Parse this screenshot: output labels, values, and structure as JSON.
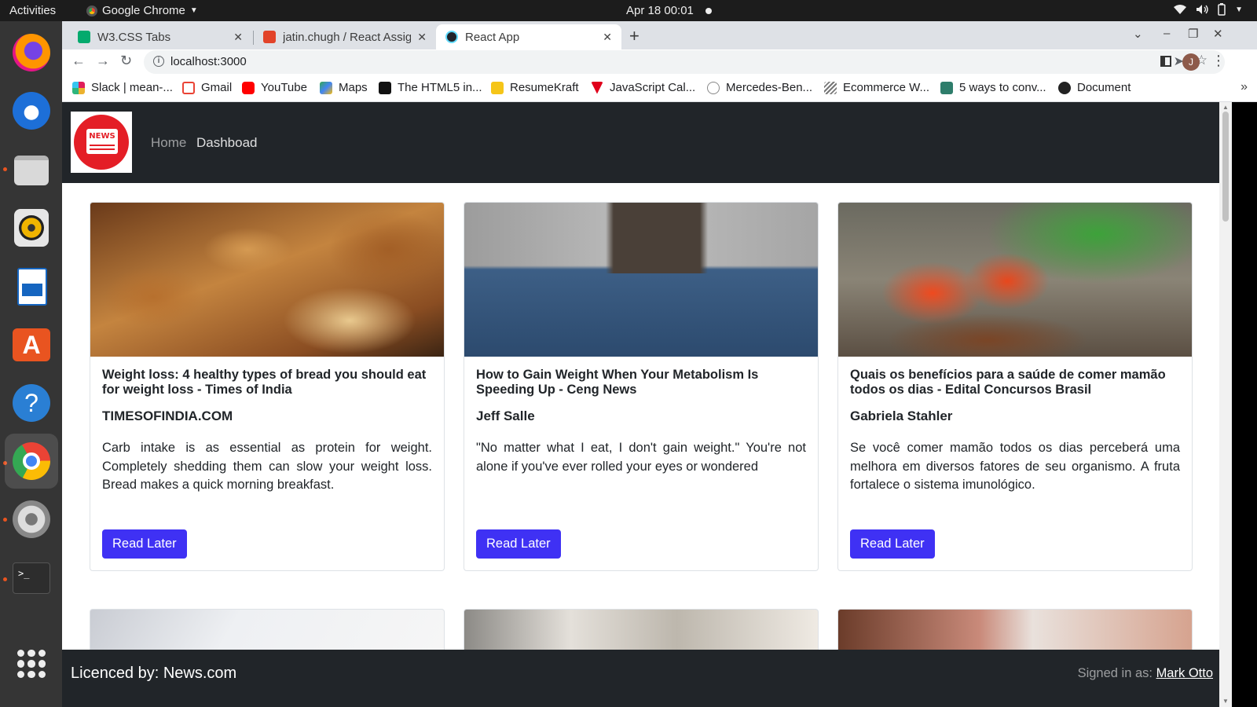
{
  "topbar": {
    "activities": "Activities",
    "app_name": "Google Chrome",
    "clock": "Apr 18  00:01"
  },
  "dock": {
    "apps": [
      "firefox-icon",
      "thunderbird-icon",
      "files-icon",
      "rhythmbox-icon",
      "writer-icon",
      "software-icon",
      "help-icon",
      "chrome-icon",
      "settings-icon",
      "terminal-icon",
      "show-apps-icon"
    ]
  },
  "browser": {
    "tabs": [
      {
        "label": "W3.CSS Tabs",
        "favicon_color": "#04aa6d"
      },
      {
        "label": "jatin.chugh / React Assign",
        "favicon_color": "#e24329"
      },
      {
        "label": "React App",
        "favicon_color": "#61dafb"
      }
    ],
    "url": "localhost:3000",
    "avatar_letter": "J",
    "bookmarks": [
      {
        "label": "Slack | mean-...",
        "color": "#e01e5a"
      },
      {
        "label": "Gmail",
        "color": "#ea4335"
      },
      {
        "label": "YouTube",
        "color": "#ff0000"
      },
      {
        "label": "Maps",
        "color": "#34a853"
      },
      {
        "label": "The HTML5 in...",
        "color": "#111111"
      },
      {
        "label": "ResumeKraft",
        "color": "#f5c518"
      },
      {
        "label": "JavaScript Cal...",
        "color": "#e0001b"
      },
      {
        "label": "Mercedes-Ben...",
        "color": "#888888"
      },
      {
        "label": "Ecommerce W...",
        "color": "#777777"
      },
      {
        "label": "5 ways to conv...",
        "color": "#2e7d6b"
      },
      {
        "label": "Document",
        "color": "#222222"
      }
    ]
  },
  "site": {
    "nav": {
      "home": "Home",
      "dashboard": "Dashboad"
    },
    "logo_text": "NEWS",
    "cards": [
      {
        "title": "Weight loss: 4 healthy types of bread you should eat for weight loss - Times of India",
        "source": "TIMESOFINDIA.COM",
        "description": "Carb intake is as essential as protein for weight. Completely shedding them can slow your weight loss. Bread makes a quick morning breakfast.",
        "button": "Read Later"
      },
      {
        "title": "How to Gain Weight When Your Metabolism Is Speeding Up - Ceng News",
        "source": "Jeff Salle",
        "description": "\"No matter what I eat, I don't gain weight.\" You're not alone if you've ever rolled your eyes or wondered",
        "button": "Read Later"
      },
      {
        "title": "Quais os benefícios para a saúde de comer mamão todos os dias - Edital Concursos Brasil",
        "source": "Gabriela Stahler",
        "description": "Se você comer mamão todos os dias perceberá uma melhora em diversos fatores de seu organismo. A fruta fortalece o sistema imunológico.",
        "button": "Read Later"
      }
    ],
    "footer": {
      "licence": "Licenced by: News.com",
      "signed_prefix": "Signed in as: ",
      "signed_user": "Mark Otto"
    },
    "colors": {
      "navbar": "#212529",
      "button": "#3f31f4",
      "logo_red": "#e41e26"
    }
  }
}
